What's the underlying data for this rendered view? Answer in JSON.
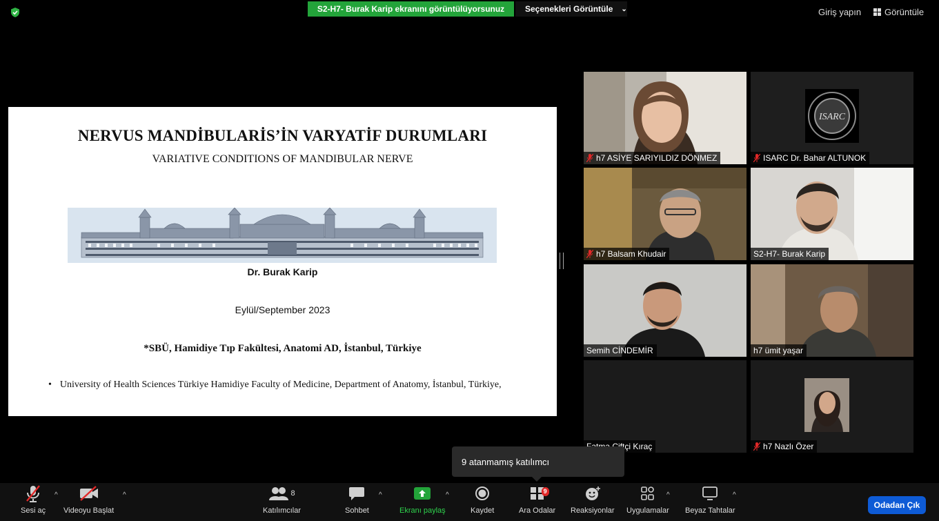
{
  "topbar": {
    "share_banner": "S2-H7- Burak Karip ekranını görüntülüyorsunuz",
    "view_options": "Seçenekleri Görüntüle",
    "sign_in": "Giriş yapın",
    "view": "Görüntüle"
  },
  "slide": {
    "title": "NERVUS MANDİBULARİS’İN VARYATİF DURUMLARI",
    "subtitle": "VARIATIVE CONDITIONS OF MANDIBULAR NERVE",
    "author": "Dr. Burak Karip",
    "date": "Eylül/September 2023",
    "institution": "*SBÜ, Hamidiye Tıp Fakültesi, Anatomi AD, İstanbul, Türkiye",
    "bullet_mark": "•",
    "bullet": "University of Health Sciences Türkiye Hamidiye Faculty of Medicine, Department of Anatomy, İstanbul, Türkiye,",
    "logo_text": "ISARC"
  },
  "participants": [
    {
      "name": "h7 ASİYE SARIYILDIZ DÖNMEZ",
      "muted": true
    },
    {
      "name": "ISARC Dr. Bahar ALTUNOK",
      "muted": true
    },
    {
      "name": "h7 Balsam Khudair",
      "muted": true
    },
    {
      "name": "S2-H7- Burak Karip",
      "muted": false,
      "active": true
    },
    {
      "name": "Semih CİNDEMİR",
      "muted": false
    },
    {
      "name": "h7 ümit yaşar",
      "muted": false
    },
    {
      "name": "Fatma Çiftçi Kıraç",
      "muted": false
    },
    {
      "name": "h7 Nazlı Özer",
      "muted": true
    }
  ],
  "tooltip": "9 atanmamış katılımcı",
  "toolbar": {
    "unmute": "Sesi aç",
    "start_video": "Videoyu Başlat",
    "participants": "Katılımcılar",
    "participants_count": "8",
    "chat": "Sohbet",
    "share_screen": "Ekranı paylaş",
    "record": "Kaydet",
    "breakout": "Ara Odalar",
    "breakout_badge": "9",
    "reactions": "Reaksiyonlar",
    "apps": "Uygulamalar",
    "whiteboard": "Beyaz Tahtalar",
    "leave": "Odadan Çık"
  },
  "colors": {
    "share_green": "#23a43a",
    "leave_blue": "#0e5bd6",
    "active_outline": "#e8ee8a",
    "muted_red": "#e02828"
  }
}
